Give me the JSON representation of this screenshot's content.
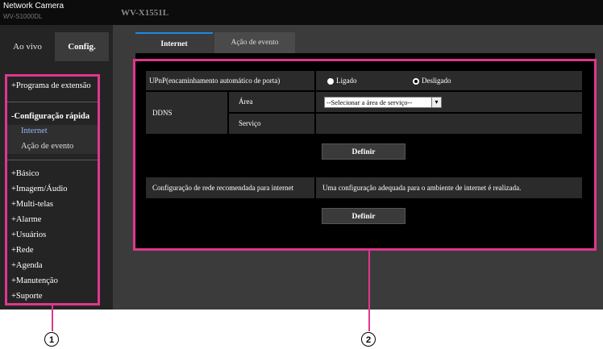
{
  "header": {
    "brand": "Network Camera",
    "brand_sub": "WV-S1000DL",
    "model": "WV-X1551L"
  },
  "left_tabs": {
    "live": "Ao vivo",
    "config": "Config."
  },
  "sidebar": {
    "extension": "+Programa de extensão",
    "quick_setup": "-Configuração rápida",
    "internet": "Internet",
    "event": "Ação de evento",
    "items": [
      "+Básico",
      "+Imagem/Áudio",
      "+Multi-telas",
      "+Alarme",
      "+Usuários",
      "+Rede",
      "+Agenda",
      "+Manutenção",
      "+Suporte"
    ]
  },
  "content_tabs": {
    "internet": "Internet",
    "event": "Ação de evento"
  },
  "upnp": {
    "label": "UPnP(encaminhamento automático de porta)",
    "on": "Ligado",
    "off": "Desligado",
    "selected": "off"
  },
  "ddns": {
    "label": "DDNS",
    "area": "Área",
    "service": "Serviço",
    "select_value": "--Selecionar a área de serviço--"
  },
  "buttons": {
    "define": "Definir"
  },
  "recommended": {
    "label": "Configuração de rede recomendada para internet",
    "text": "Uma configuração adequada para o ambiente de internet é realizada."
  },
  "callouts": {
    "one": "1",
    "two": "2"
  },
  "colors": {
    "highlight": "#e0368e",
    "active_tab": "#1e88e5",
    "selected_menu": "#9ab4ff"
  }
}
